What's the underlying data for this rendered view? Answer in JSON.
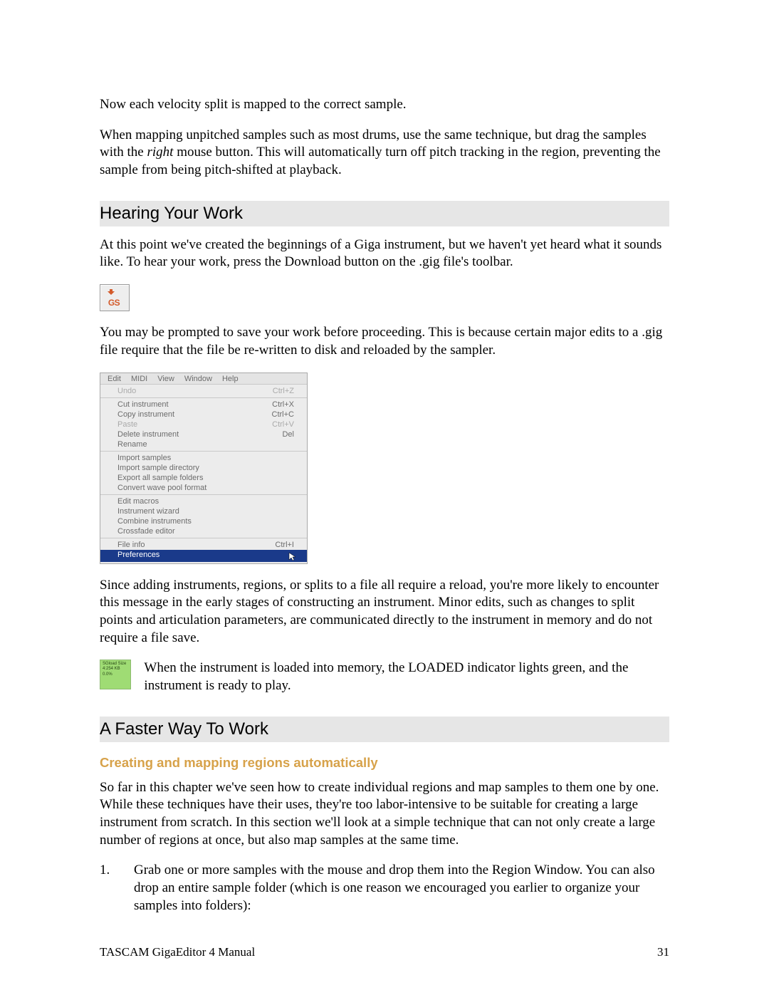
{
  "paragraphs": {
    "p1": "Now each velocity split is mapped to the correct sample.",
    "p2_a": "When mapping unpitched samples such as most drums, use the same technique, but drag the samples with the ",
    "p2_italic": "right",
    "p2_b": " mouse button.  This will automatically turn off pitch tracking in the region, preventing the sample from being pitch-shifted at playback.",
    "p3": "At this point we've created the beginnings of a Giga instrument, but we haven't yet heard what it sounds like.  To hear your work, press the Download button on the .gig file's toolbar.",
    "p4": "You may be prompted to save your work before proceeding.  This is because certain major edits to a .gig file require that the file be re-written to disk and reloaded by the sampler.",
    "p5": "Since adding instruments, regions, or splits to a file all require a reload, you're more likely to encounter this message in the early stages of constructing an instrument.  Minor edits, such as changes to split points and articulation parameters, are communicated directly to the instrument in memory and do not require a file save.",
    "p6": "When the instrument is loaded into memory, the LOADED indicator lights green, and the instrument is ready to play.",
    "p7": "So far in this chapter we've seen how to create individual regions and map samples to them one by one.  While these techniques have their uses, they're too labor-intensive to be suitable for creating a large instrument from scratch.  In this section we'll look at a simple technique that can not only create a large number of regions at once, but also map samples at the same time."
  },
  "headings": {
    "h_hearing": "Hearing Your Work",
    "h_faster": "A Faster Way To Work",
    "h_creating": "Creating and mapping regions automatically"
  },
  "steps": {
    "s1": "Grab one or more samples with the mouse and drop them into the Region Window.  You can also drop an entire sample folder (which is one reason we encouraged you earlier to organize your samples into folders):"
  },
  "gs_icon": "GS",
  "menu": {
    "menubar": [
      "Edit",
      "MIDI",
      "View",
      "Window",
      "Help"
    ],
    "groups": [
      [
        {
          "label": "Undo",
          "shortcut": "Ctrl+Z",
          "disabled": true
        }
      ],
      [
        {
          "label": "Cut instrument",
          "shortcut": "Ctrl+X"
        },
        {
          "label": "Copy instrument",
          "shortcut": "Ctrl+C"
        },
        {
          "label": "Paste",
          "shortcut": "Ctrl+V",
          "disabled": true
        },
        {
          "label": "Delete instrument",
          "shortcut": "Del"
        },
        {
          "label": "Rename",
          "shortcut": ""
        }
      ],
      [
        {
          "label": "Import samples",
          "shortcut": ""
        },
        {
          "label": "Import sample directory",
          "shortcut": ""
        },
        {
          "label": "Export all sample folders",
          "shortcut": ""
        },
        {
          "label": "Convert wave pool format",
          "shortcut": ""
        }
      ],
      [
        {
          "label": "Edit macros",
          "shortcut": ""
        },
        {
          "label": "Instrument wizard",
          "shortcut": ""
        },
        {
          "label": "Combine instruments",
          "shortcut": ""
        },
        {
          "label": "Crossfade editor",
          "shortcut": ""
        }
      ],
      [
        {
          "label": "File info",
          "shortcut": "Ctrl+I"
        },
        {
          "label": "Preferences",
          "shortcut": "",
          "selected": true
        }
      ]
    ]
  },
  "loaded_box": {
    "l1": "SGload Size",
    "l2": "4:254 KB",
    "l3": "0.0%"
  },
  "footer": {
    "left": "TASCAM GigaEditor 4 Manual",
    "right": "31"
  }
}
